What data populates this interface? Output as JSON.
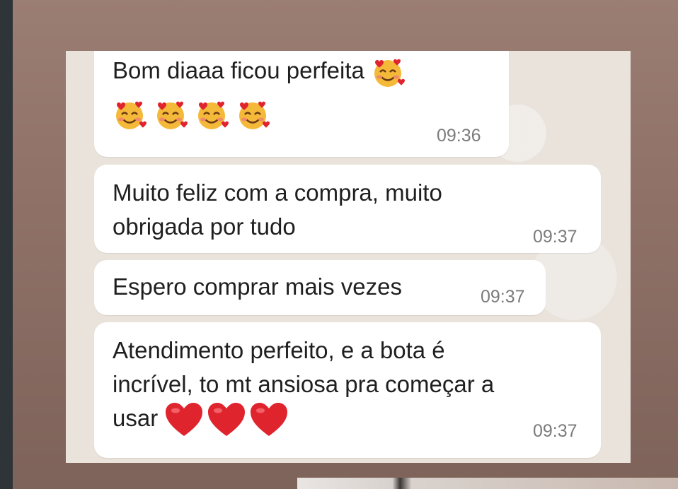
{
  "messages": [
    {
      "text": "Bom diaaa ficou perfeita",
      "time": "09:36",
      "emoji_after_text": "smiling-face-with-hearts",
      "emoji_row": [
        "smiling-face-with-hearts",
        "smiling-face-with-hearts",
        "smiling-face-with-hearts",
        "smiling-face-with-hearts"
      ]
    },
    {
      "text": "Muito feliz com a compra, muito\nobrigada por tudo",
      "time": "09:37"
    },
    {
      "text": "Espero comprar mais vezes",
      "time": "09:37"
    },
    {
      "text": "Atendimento perfeito, e a bota é\nincrível, to mt ansiosa pra começar a\nusar",
      "time": "09:37",
      "hearts": [
        "red-heart",
        "red-heart",
        "red-heart"
      ]
    }
  ],
  "colors": {
    "bubble": "#ffffff",
    "chat_background": "#e9e3dc",
    "timestamp": "#7b7b7b",
    "heart": "#e0242e"
  }
}
